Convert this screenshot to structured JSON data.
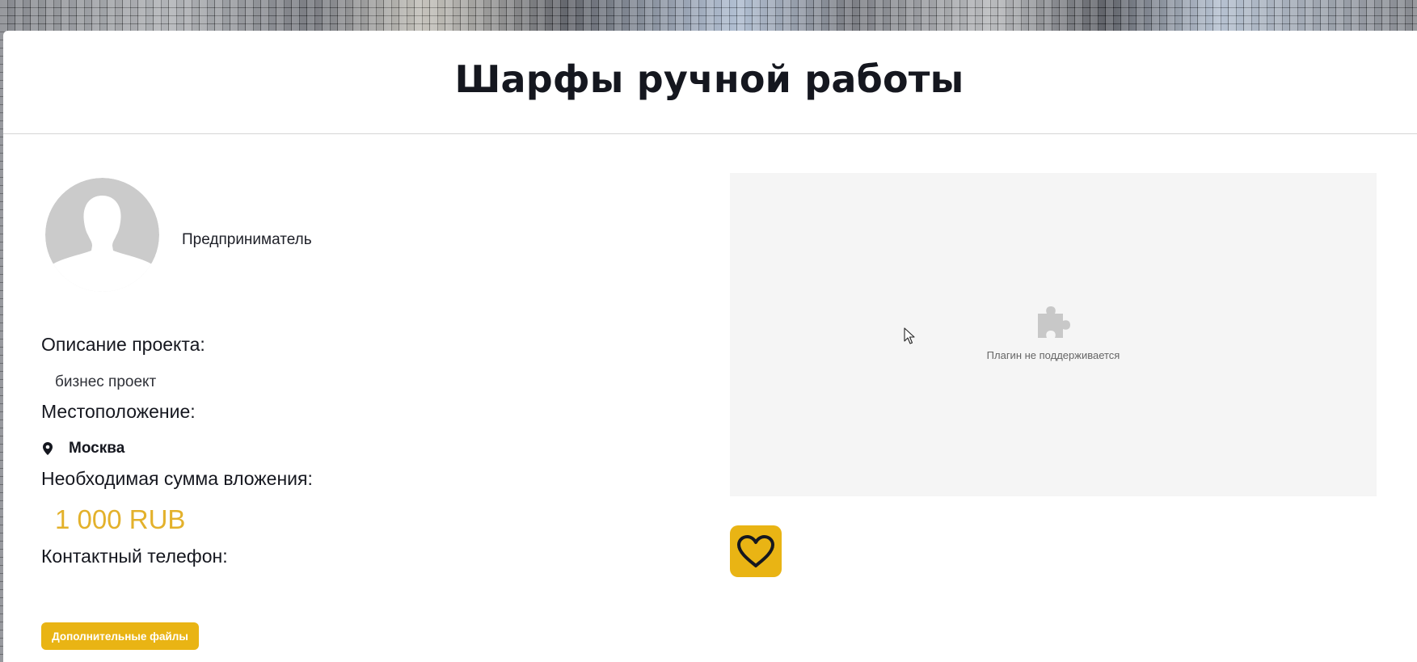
{
  "header": {
    "title": "Шарфы ручной работы"
  },
  "owner": {
    "avatar_icon": "user-silhouette-icon",
    "role": "Предприниматель"
  },
  "project": {
    "description_label": "Описание проекта:",
    "description": "бизнес проект",
    "location_label": "Местоположение:",
    "location_icon": "map-pin-icon",
    "city": "Москва",
    "investment_label": "Необходимая сумма вложения:",
    "investment_amount": "1 000 RUB",
    "phone_label": "Контактный телефон:",
    "phone": ""
  },
  "actions": {
    "files_button_label": "Дополнительные файлы",
    "favorite_icon": "heart-icon"
  },
  "media": {
    "plugin_icon": "puzzle-piece-icon",
    "plugin_message": "Плагин не поддерживается"
  },
  "colors": {
    "accent": "#e9b414",
    "amount": "#e3b12b",
    "title": "#15171f",
    "plugin_background": "#f5f5f5"
  }
}
